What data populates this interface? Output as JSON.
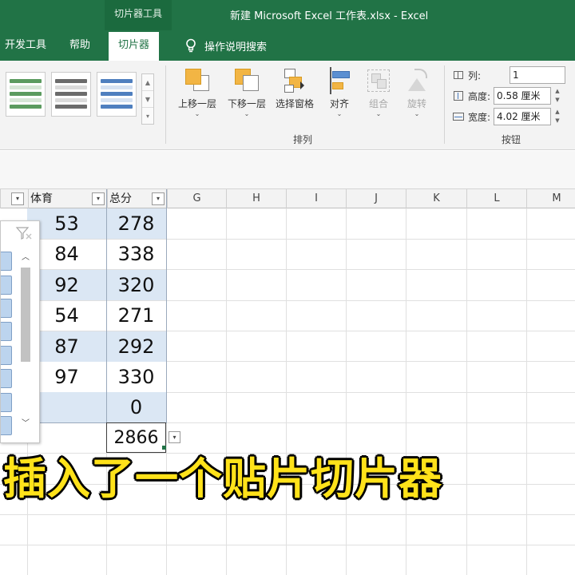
{
  "titlebar": {
    "contextual_group": "切片器工具",
    "document_title": "新建 Microsoft Excel 工作表.xlsx  -  Excel"
  },
  "tabs": [
    {
      "label": "开发工具",
      "active": false
    },
    {
      "label": "帮助",
      "active": false
    },
    {
      "label": "切片器",
      "active": true
    }
  ],
  "tell_me": {
    "label": "操作说明搜索",
    "icon": "lightbulb-icon"
  },
  "ribbon": {
    "arrange": {
      "buttons": [
        {
          "label": "上移一层",
          "icon": "bring-forward-icon",
          "enabled": true
        },
        {
          "label": "下移一层",
          "icon": "send-backward-icon",
          "enabled": true
        },
        {
          "label": "选择窗格",
          "icon": "selection-pane-icon",
          "enabled": true
        },
        {
          "label": "对齐",
          "icon": "align-icon",
          "enabled": true
        },
        {
          "label": "组合",
          "icon": "group-icon",
          "enabled": false
        },
        {
          "label": "旋转",
          "icon": "rotate-icon",
          "enabled": false
        }
      ],
      "group_label": "排列"
    },
    "buttons_group": {
      "columns_label": "列:",
      "columns_value": "1",
      "height_label": "高度:",
      "height_value": "0.58 厘米",
      "width_label": "宽度:",
      "width_value": "4.02 厘米",
      "group_label": "按钮"
    },
    "style_swatches": [
      {
        "name": "green",
        "color": "#5b9b5f"
      },
      {
        "name": "gray",
        "color": "#6b6b6b"
      },
      {
        "name": "blue",
        "color": "#4f7fbf"
      }
    ]
  },
  "sheet": {
    "column_headers": [
      "G",
      "H",
      "I",
      "J",
      "K",
      "L",
      "M"
    ],
    "table_headers": {
      "sports": "体育",
      "total": "总分"
    },
    "rows": [
      {
        "sports": "53",
        "total": "278"
      },
      {
        "sports": "84",
        "total": "338"
      },
      {
        "sports": "92",
        "total": "320"
      },
      {
        "sports": "54",
        "total": "271"
      },
      {
        "sports": "87",
        "total": "292"
      },
      {
        "sports": "97",
        "total": "330"
      },
      {
        "sports": "",
        "total": "0"
      }
    ],
    "total_row_value": "2866"
  },
  "colors": {
    "excel_green": "#217346",
    "band_blue": "#dbe7f4",
    "caption_yellow": "#ffe21a"
  },
  "caption": "插入了一个贴片切片器"
}
